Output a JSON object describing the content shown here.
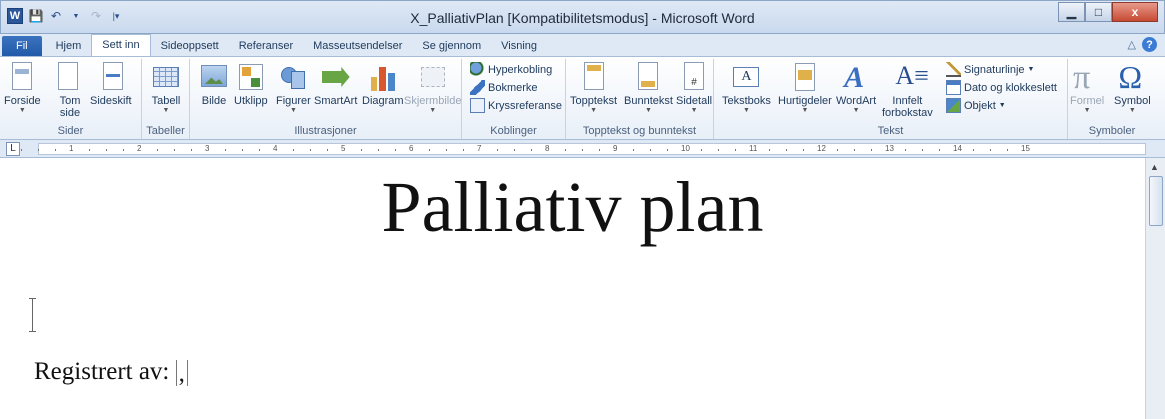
{
  "window": {
    "title": "X_PalliativPlan [Kompatibilitetsmodus] - Microsoft Word",
    "app_icon": "word-icon",
    "minimize": "▁",
    "maximize": "□",
    "close": "x"
  },
  "tabs": [
    {
      "label": "Fil"
    },
    {
      "label": "Hjem"
    },
    {
      "label": "Sett inn"
    },
    {
      "label": "Sideoppsett"
    },
    {
      "label": "Referanser"
    },
    {
      "label": "Masseutsendelser"
    },
    {
      "label": "Se gjennom"
    },
    {
      "label": "Visning"
    }
  ],
  "active_tab": "Sett inn",
  "ribbon": {
    "groups": {
      "sider": {
        "label": "Sider",
        "forside": "Forside",
        "tom_side_1": "Tom",
        "tom_side_2": "side",
        "sideskift": "Sideskift"
      },
      "tabeller": {
        "label": "Tabeller",
        "tabell": "Tabell"
      },
      "illustrasjoner": {
        "label": "Illustrasjoner",
        "bilde": "Bilde",
        "utklipp": "Utklipp",
        "figurer": "Figurer",
        "smartart": "SmartArt",
        "diagram": "Diagram",
        "skjermbilde": "Skjermbilde"
      },
      "koblinger": {
        "label": "Koblinger",
        "hyperkobling": "Hyperkobling",
        "bokmerke": "Bokmerke",
        "kryssreferanse": "Kryssreferanse"
      },
      "topptekst": {
        "label": "Topptekst og bunntekst",
        "topptekst": "Topptekst",
        "bunntekst": "Bunntekst",
        "sidetall": "Sidetall"
      },
      "tekst": {
        "label": "Tekst",
        "tekstboks": "Tekstboks",
        "hurtigdeler": "Hurtigdeler",
        "wordart": "WordArt",
        "innfelt_1": "Innfelt",
        "innfelt_2": "forbokstav",
        "signaturlinje": "Signaturlinje",
        "dato": "Dato og klokkeslett",
        "objekt": "Objekt"
      },
      "symboler": {
        "label": "Symboler",
        "formel": "Formel",
        "symbol": "Symbol"
      }
    }
  },
  "ruler": {
    "tab_marker": "L",
    "numbers": [
      "1",
      "2",
      "3",
      "4",
      "5",
      "6",
      "7",
      "8",
      "9",
      "10",
      "11",
      "12",
      "13",
      "14",
      "15"
    ]
  },
  "document": {
    "title": "Palliativ plan",
    "registered_label": "Registrert av:",
    "field_value": ","
  },
  "colors": {
    "accent": "#2b579a",
    "ribbon_bg": "#dfe9f5",
    "file_tab": "#215aa8"
  }
}
